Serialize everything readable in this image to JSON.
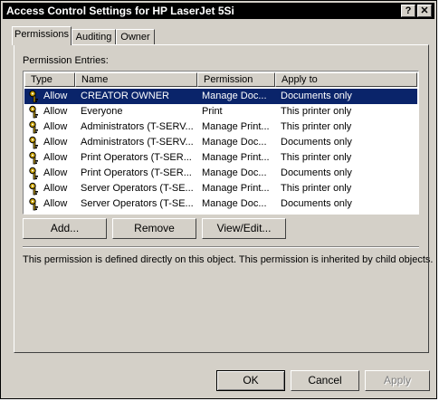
{
  "window": {
    "title": "Access Control Settings for HP LaserJet 5Si",
    "help_button": "?",
    "close_button": "✕"
  },
  "tabs": [
    {
      "label": "Permissions",
      "active": true
    },
    {
      "label": "Auditing",
      "active": false
    },
    {
      "label": "Owner",
      "active": false
    }
  ],
  "permissions": {
    "entries_label": "Permission Entries:",
    "columns": [
      "Type",
      "Name",
      "Permission",
      "Apply to"
    ],
    "rows": [
      {
        "type": "Allow",
        "name": "CREATOR OWNER",
        "permission": "Manage Doc...",
        "apply_to": "Documents only",
        "selected": true
      },
      {
        "type": "Allow",
        "name": "Everyone",
        "permission": "Print",
        "apply_to": "This printer only",
        "selected": false
      },
      {
        "type": "Allow",
        "name": "Administrators (T-SERV...",
        "permission": "Manage Print...",
        "apply_to": "This printer only",
        "selected": false
      },
      {
        "type": "Allow",
        "name": "Administrators (T-SERV...",
        "permission": "Manage Doc...",
        "apply_to": "Documents only",
        "selected": false
      },
      {
        "type": "Allow",
        "name": "Print Operators (T-SER...",
        "permission": "Manage Print...",
        "apply_to": "This printer only",
        "selected": false
      },
      {
        "type": "Allow",
        "name": "Print Operators (T-SER...",
        "permission": "Manage Doc...",
        "apply_to": "Documents only",
        "selected": false
      },
      {
        "type": "Allow",
        "name": "Server Operators (T-SE...",
        "permission": "Manage Print...",
        "apply_to": "This printer only",
        "selected": false
      },
      {
        "type": "Allow",
        "name": "Server Operators (T-SE...",
        "permission": "Manage Doc...",
        "apply_to": "Documents only",
        "selected": false
      }
    ],
    "row_icon": "key-icon",
    "add_label": "Add...",
    "remove_label": "Remove",
    "view_edit_label": "View/Edit...",
    "info_text": "This permission is defined directly on this object. This permission is inherited by child objects."
  },
  "footer": {
    "ok_label": "OK",
    "cancel_label": "Cancel",
    "apply_label": "Apply"
  },
  "colors": {
    "dialog": "#d4d0c8",
    "selection": "#0a246a",
    "titlebar": "#000000"
  }
}
